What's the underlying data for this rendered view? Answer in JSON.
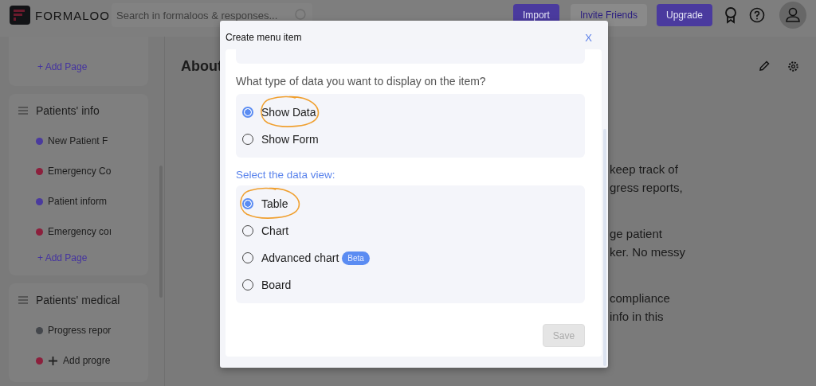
{
  "header": {
    "logo": "FORMALOO",
    "search": {
      "placeholder": "Search in formaloos & responses..."
    },
    "buttons": [
      {
        "label": "Import",
        "kind": "primary"
      },
      {
        "label": "Invite Friends",
        "kind": "secondary"
      },
      {
        "label": "Upgrade",
        "kind": "primary"
      }
    ]
  },
  "sidebar": {
    "sections": [
      {
        "add_label": "+ Add Page"
      },
      {
        "title": "Patients' info",
        "items": [
          {
            "label": "New Patient F",
            "color": "#4a3a9e",
            "kind": "page"
          },
          {
            "label": "Emergency Co",
            "color": "#8c1f3c",
            "kind": "page"
          },
          {
            "label": "Patient inform",
            "color": "#4a3a9e",
            "kind": "page"
          },
          {
            "label": "Emergency coı",
            "color": "#8c1f3c",
            "kind": "page"
          }
        ],
        "add_label": "+ Add Page"
      },
      {
        "title": "Patients' medical",
        "items": [
          {
            "label": "Progress repor",
            "color": "#44474c",
            "kind": "page"
          },
          {
            "label": "Add progre",
            "color": "#8c1f3c",
            "kind": "add"
          }
        ]
      }
    ]
  },
  "main": {
    "title": "About",
    "text_lines": [
      "keep track of",
      "gress reports,",
      "ge patient",
      "ker. No messy",
      "compliance",
      "info in this"
    ]
  },
  "modal": {
    "title": "Create menu item",
    "close": "X",
    "question": "What type of data you want to display on the item?",
    "data_types": [
      {
        "label": "Show Data",
        "selected": true,
        "circled": true
      },
      {
        "label": "Show Form",
        "selected": false,
        "circled": false
      }
    ],
    "view_label": "Select the data view:",
    "views": [
      {
        "label": "Table",
        "selected": true,
        "circled": true
      },
      {
        "label": "Chart",
        "selected": false,
        "circled": false
      },
      {
        "label": "Advanced chart",
        "badge": "Beta",
        "selected": false,
        "circled": false
      },
      {
        "label": "Board",
        "selected": false,
        "circled": false
      }
    ],
    "save": {
      "label": "Save",
      "disabled": true
    }
  }
}
